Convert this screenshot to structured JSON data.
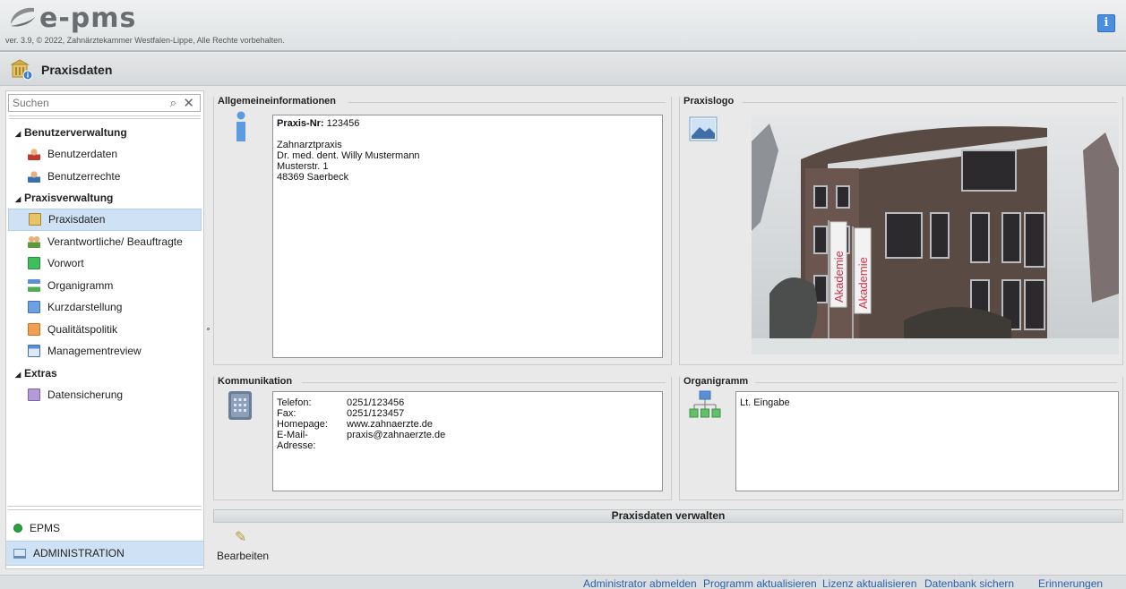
{
  "app": {
    "name": "e-pms",
    "version": "ver. 3.9, © 2022, Zahnärztekammer Westfalen-Lippe, Alle Rechte vorbehalten.",
    "info_label": "i"
  },
  "page": {
    "title": "Praxisdaten"
  },
  "sidebar": {
    "search_placeholder": "Suchen",
    "groups": [
      {
        "label": "Benutzerverwaltung",
        "items": [
          {
            "label": "Benutzerdaten"
          },
          {
            "label": "Benutzerrechte"
          }
        ]
      },
      {
        "label": "Praxisverwaltung",
        "items": [
          {
            "label": "Praxisdaten",
            "selected": true
          },
          {
            "label": "Verantwortliche/ Beauftragte"
          },
          {
            "label": "Vorwort"
          },
          {
            "label": "Organigramm"
          },
          {
            "label": "Kurzdarstellung"
          },
          {
            "label": "Qualitätspolitik"
          },
          {
            "label": "Managementreview"
          }
        ]
      },
      {
        "label": "Extras",
        "items": [
          {
            "label": "Datensicherung"
          }
        ]
      }
    ],
    "nav": {
      "epms": "EPMS",
      "admin": "ADMINISTRATION"
    }
  },
  "panels": {
    "general": {
      "title": "Allgemeineinformationen",
      "praxis_nr_label": "Praxis-Nr:",
      "praxis_nr": "123456",
      "lines": [
        "Zahnarztpraxis",
        "Dr. med. dent. Willy Mustermann",
        "Musterstr. 1",
        "48369 Saerbeck"
      ]
    },
    "logo": {
      "title": "Praxislogo",
      "banner_text": "Akademie"
    },
    "communication": {
      "title": "Kommunikation",
      "rows": [
        {
          "key": "Telefon:",
          "value": "0251/123456"
        },
        {
          "key": "Fax:",
          "value": "0251/123457"
        },
        {
          "key": "Homepage:",
          "value": "www.zahnaerzte.de"
        },
        {
          "key": "E-Mail-Adresse:",
          "value": "praxis@zahnaerzte.de"
        }
      ]
    },
    "organigram": {
      "title": "Organigramm",
      "text": "Lt. Eingabe"
    }
  },
  "toolbar": {
    "title": "Praxisdaten verwalten",
    "edit_label": "Bearbeiten"
  },
  "footer": {
    "links": [
      "Administrator abmelden",
      "Programm aktualisieren",
      "Lizenz aktualisieren",
      "Datenbank sichern",
      "Erinnerungen"
    ]
  }
}
